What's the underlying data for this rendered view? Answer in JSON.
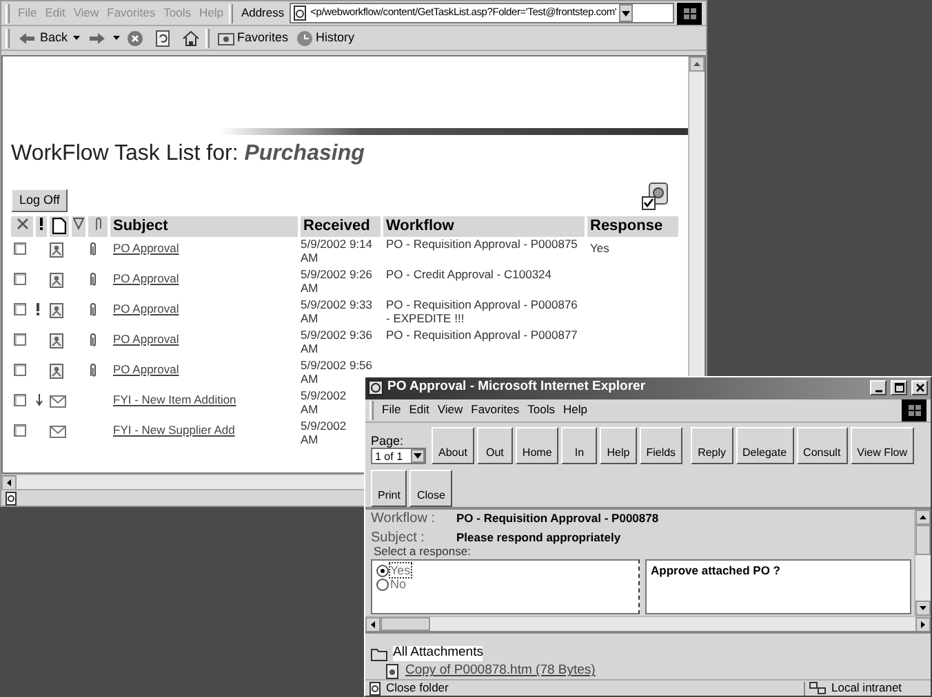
{
  "main_window": {
    "active": false,
    "menu": [
      "File",
      "Edit",
      "View",
      "Favorites",
      "Tools",
      "Help"
    ],
    "address_label": "Address",
    "address": "<p/webworkflow/content/GetTaskList.asp?Folder='Test@frontstep.com'",
    "toolbar": [
      {
        "kind": "back",
        "label": "Back"
      },
      {
        "kind": "forward"
      },
      {
        "kind": "stop"
      },
      {
        "kind": "refresh"
      },
      {
        "kind": "home"
      },
      {
        "kind": "favorites",
        "label": "Favorites"
      },
      {
        "kind": "history",
        "label": "History"
      }
    ]
  },
  "page": {
    "title": "WorkFlow Task List for:",
    "folder": "Purchasing",
    "logoff": "Log Off",
    "columns": [
      "Subject",
      "Received",
      "Workflow",
      "Response"
    ],
    "rows": [
      {
        "checked": false,
        "urgent": false,
        "low_priority": false,
        "kind": "workflow",
        "attachment": true,
        "subject": "PO Approval",
        "received": [
          "5/9/2002 9:14",
          "AM"
        ],
        "workflow": "PO - Requisition Approval - P000875",
        "response": "Yes"
      },
      {
        "checked": false,
        "urgent": false,
        "low_priority": false,
        "kind": "workflow",
        "attachment": true,
        "subject": "PO Approval",
        "received": [
          "5/9/2002 9:26",
          "AM"
        ],
        "workflow": "PO - Credit Approval - C100324"
      },
      {
        "checked": false,
        "urgent": true,
        "low_priority": false,
        "kind": "workflow",
        "attachment": true,
        "subject": "PO Approval",
        "received": [
          "5/9/2002 9:33",
          "AM"
        ],
        "workflow": "PO - Requisition Approval - P000876 - EXPEDITE !!!"
      },
      {
        "checked": false,
        "urgent": false,
        "low_priority": false,
        "kind": "workflow",
        "attachment": true,
        "subject": "PO Approval",
        "received": [
          "5/9/2002 9:36",
          "AM"
        ],
        "workflow": "PO - Requisition Approval - P000877"
      },
      {
        "checked": false,
        "urgent": false,
        "low_priority": false,
        "kind": "workflow",
        "attachment": true,
        "subject": "PO Approval",
        "received": [
          "5/9/2002 9:56",
          "AM"
        ]
      },
      {
        "checked": false,
        "urgent": false,
        "low_priority": true,
        "kind": "message",
        "attachment": false,
        "subject": "FYI - New Item Addition",
        "received": [
          "5/9/2002",
          "AM"
        ]
      },
      {
        "checked": false,
        "urgent": false,
        "low_priority": false,
        "kind": "message",
        "attachment": false,
        "subject": "FYI - New Supplier Add",
        "received": [
          "5/9/2002",
          "AM"
        ]
      }
    ]
  },
  "popup": {
    "active": true,
    "title": "PO Approval - Microsoft Internet Explorer",
    "menu": [
      "File",
      "Edit",
      "View",
      "Favorites",
      "Tools",
      "Help"
    ],
    "page_label": "Page:",
    "page_value": "1 of 1",
    "buttons": [
      "About",
      "Out",
      "Home",
      "In",
      "Help",
      "Fields",
      "Reply",
      "Delegate",
      "Consult",
      "View Flow",
      "Print",
      "Close"
    ],
    "workflow_label": "Workflow :",
    "workflow": "PO - Requisition Approval - P000878",
    "subject_label": "Subject :",
    "subject": "Please respond appropriately",
    "prompt": "Select a response:",
    "options": [
      {
        "label": "Yes",
        "selected": true
      },
      {
        "label": "No",
        "selected": false
      }
    ],
    "message": "Approve attached PO ?",
    "attachments": {
      "label": "All Attachments",
      "children": [
        {
          "label": "Copy of P000878.htm (78 Bytes)"
        }
      ]
    },
    "status": "Close folder",
    "zone": "Local intranet"
  }
}
